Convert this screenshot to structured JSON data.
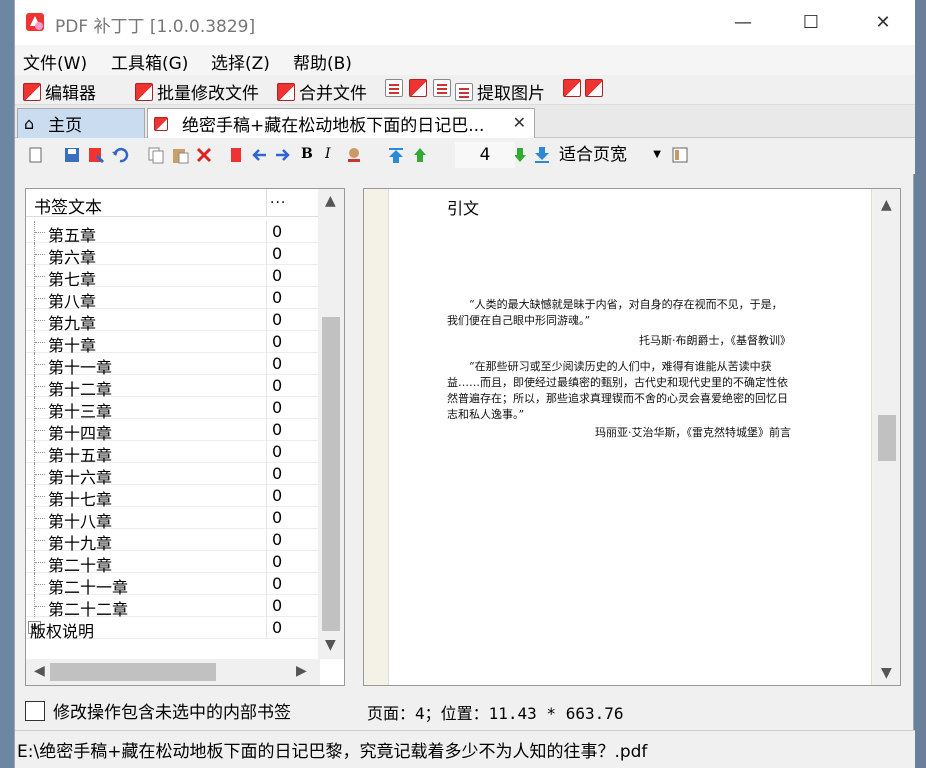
{
  "window": {
    "title": "PDF 补丁丁 [1.0.0.3829]",
    "minimize": "—",
    "maximize": "☐",
    "close": "✕"
  },
  "menu": [
    "文件(W)",
    "工具箱(G)",
    "选择(Z)",
    "帮助(B)"
  ],
  "toolbar1": {
    "editor": "编辑器",
    "batch": "批量修改文件",
    "merge": "合并文件",
    "extract": "提取图片"
  },
  "tabs": {
    "home": "主页",
    "doc": "绝密手稿+藏在松动地板下面的日记巴...",
    "close": "✕"
  },
  "toolbar2": {
    "bold": "B",
    "italic": "I",
    "page": "4",
    "zoom": "适合页宽"
  },
  "bookmarks": {
    "col1": "书签文本",
    "col2": "...",
    "items": [
      {
        "name": "第五章",
        "val": "0"
      },
      {
        "name": "第六章",
        "val": "0"
      },
      {
        "name": "第七章",
        "val": "0"
      },
      {
        "name": "第八章",
        "val": "0"
      },
      {
        "name": "第九章",
        "val": "0"
      },
      {
        "name": "第十章",
        "val": "0"
      },
      {
        "name": "第十一章",
        "val": "0"
      },
      {
        "name": "第十二章",
        "val": "0"
      },
      {
        "name": "第十三章",
        "val": "0"
      },
      {
        "name": "第十四章",
        "val": "0"
      },
      {
        "name": "第十五章",
        "val": "0"
      },
      {
        "name": "第十六章",
        "val": "0"
      },
      {
        "name": "第十七章",
        "val": "0"
      },
      {
        "name": "第十八章",
        "val": "0"
      },
      {
        "name": "第十九章",
        "val": "0"
      },
      {
        "name": "第二十章",
        "val": "0"
      },
      {
        "name": "第二十一章",
        "val": "0"
      },
      {
        "name": "第二十二章",
        "val": "0"
      },
      {
        "name": "版权说明",
        "val": "0"
      }
    ]
  },
  "page": {
    "heading": "引文",
    "quote1_line1": "“人类的最大缺憾就是昧于内省，对自身的存在视而不见，于是，",
    "quote1_line2": "我们便在自己眼中形同游魂。”",
    "attr1": "托马斯·布朗爵士，《基督教训》",
    "quote2_line1": "“在那些研习或至少阅读历史的人们中，难得有谁能从苦读中获",
    "quote2_line2": "益……而且，即使经过最缜密的甄别，古代史和现代史里的不确定性依",
    "quote2_line3": "然普遍存在；所以，那些追求真理锲而不舍的心灵会喜爱绝密的回忆日",
    "quote2_line4": "志和私人逸事。”",
    "attr2": "玛丽亚·艾治华斯，《雷克然特城堡》前言"
  },
  "bottom": {
    "checkbox_label": "修改操作包含未选中的内部书签",
    "position": "页面：4；位置：11.43 * 663.76"
  },
  "status": {
    "path": "E:\\绝密手稿+藏在松动地板下面的日记巴黎，究竟记载着多少不为人知的往事？.pdf"
  }
}
